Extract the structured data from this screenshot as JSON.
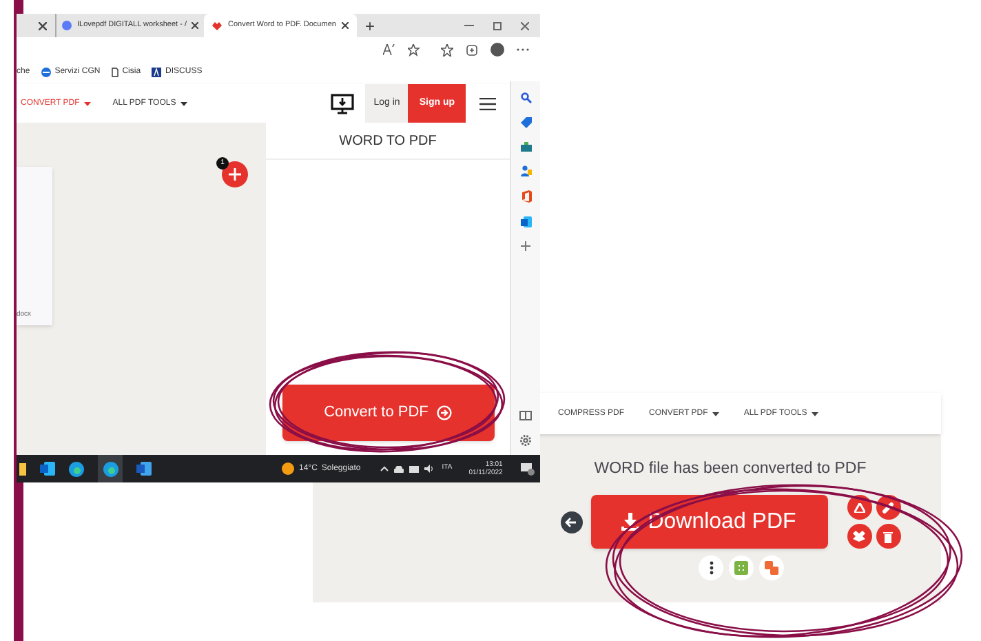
{
  "browser": {
    "tabs": [
      {
        "title": "ILovepdf DIGITALL worksheet - /",
        "selected": false
      },
      {
        "title": "Convert Word to PDF. Documen",
        "selected": true
      }
    ],
    "new_tab": "+",
    "bookmarks": [
      "che",
      "Servizi CGN",
      "Cisia",
      "DISCUSS"
    ]
  },
  "site_nav": {
    "menus": [
      {
        "label": "CONVERT PDF",
        "selected": true,
        "dropdown": true
      },
      {
        "label": "ALL PDF TOOLS",
        "selected": false,
        "dropdown": true
      }
    ],
    "login": "Log in",
    "signup": "Sign up"
  },
  "upload": {
    "file_name": "docx",
    "badge": "1"
  },
  "panel": {
    "title": "WORD TO PDF",
    "button": "Convert to PDF"
  },
  "taskbar": {
    "temperature": "14°C",
    "weather": "Soleggiato",
    "language": "ITA",
    "time": "13:01",
    "date": "01/11/2022"
  },
  "result": {
    "nav": [
      {
        "label": "COMPRESS PDF",
        "dropdown": false
      },
      {
        "label": "CONVERT PDF",
        "dropdown": true
      },
      {
        "label": "ALL PDF TOOLS",
        "dropdown": true
      }
    ],
    "message": "WORD file has been converted to PDF",
    "button": "Download PDF"
  }
}
